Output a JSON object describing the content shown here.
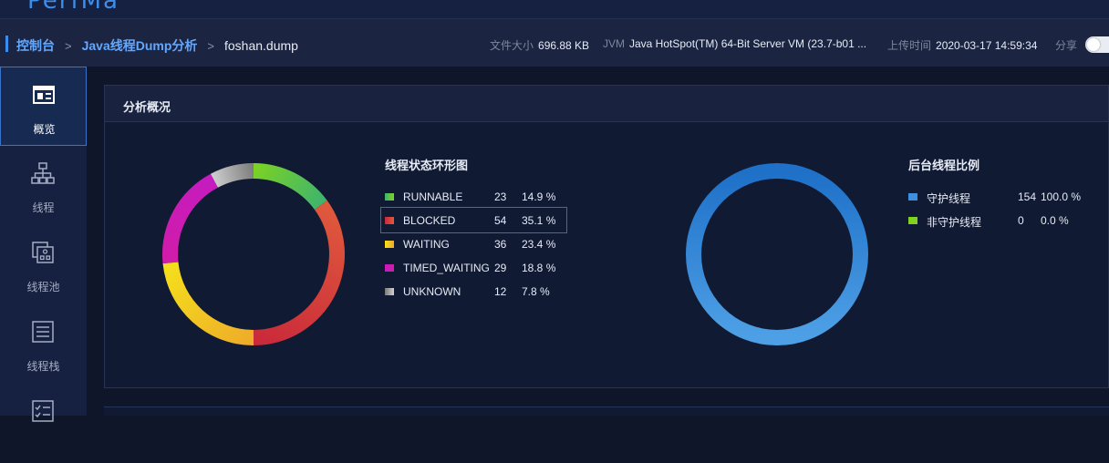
{
  "header": {
    "logo": "PerfMa"
  },
  "breadcrumb": {
    "items": [
      "控制台",
      "Java线程Dump分析",
      "foshan.dump"
    ],
    "separator": ">"
  },
  "meta": {
    "file_size_label": "文件大小",
    "file_size": "696.88 KB",
    "jvm_label": "JVM",
    "jvm": "Java HotSpot(TM) 64-Bit Server VM (23.7-b01 ...",
    "upload_label": "上传时间",
    "upload_time": "2020-03-17 14:59:34",
    "share_label": "分享"
  },
  "sidebar": {
    "items": [
      {
        "label": "概览",
        "icon": "overview-icon"
      },
      {
        "label": "线程",
        "icon": "hierarchy-icon"
      },
      {
        "label": "线程池",
        "icon": "thread-pool-icon"
      },
      {
        "label": "线程栈",
        "icon": "stack-icon"
      },
      {
        "label": "",
        "icon": "checklist-icon"
      }
    ]
  },
  "panel": {
    "title": "分析概况"
  },
  "thread_state": {
    "title": "线程状态环形图",
    "rows": [
      {
        "name": "RUNNABLE",
        "count": "23",
        "percent": "14.9 %",
        "value": 23,
        "color": "#3cb371",
        "color2": "#7ed321"
      },
      {
        "name": "BLOCKED",
        "count": "54",
        "percent": "35.1 %",
        "value": 54,
        "color": "#c9283a",
        "color2": "#e05a3c"
      },
      {
        "name": "WAITING",
        "count": "36",
        "percent": "23.4 %",
        "value": 36,
        "color": "#f5e11b",
        "color2": "#eeaa2a"
      },
      {
        "name": "TIMED_WAITING",
        "count": "29",
        "percent": "18.8 %",
        "value": 29,
        "color": "#c41cc0",
        "color2": "#d11ca8"
      },
      {
        "name": "UNKNOWN",
        "count": "12",
        "percent": "7.8 %",
        "value": 12,
        "color": "#7a7a7a",
        "color2": "#d0d0d0"
      }
    ]
  },
  "daemon_ratio": {
    "title": "后台线程比例",
    "rows": [
      {
        "name": "守护线程",
        "count": "154",
        "percent": "100.0 %",
        "value": 154,
        "color": "#3e8fe0"
      },
      {
        "name": "非守护线程",
        "count": "0",
        "percent": "0.0 %",
        "value": 0,
        "color": "#7ed321"
      }
    ]
  },
  "chart_data": [
    {
      "type": "pie",
      "title": "线程状态环形图",
      "categories": [
        "RUNNABLE",
        "BLOCKED",
        "WAITING",
        "TIMED_WAITING",
        "UNKNOWN"
      ],
      "values": [
        23,
        54,
        36,
        29,
        12
      ]
    },
    {
      "type": "pie",
      "title": "后台线程比例",
      "categories": [
        "守护线程",
        "非守护线程"
      ],
      "values": [
        154,
        0
      ]
    }
  ]
}
